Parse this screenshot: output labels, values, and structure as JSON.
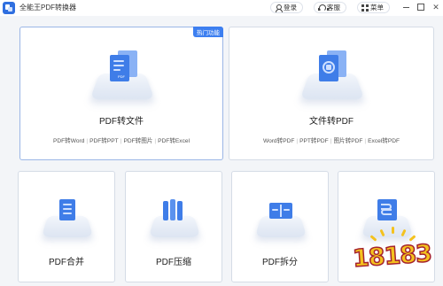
{
  "titlebar": {
    "app_title": "全能王PDF转换器",
    "login_label": "登录",
    "service_label": "客服",
    "menu_label": "菜单"
  },
  "cards": {
    "pdf_to_doc": {
      "badge": "热门功能",
      "title": "PDF转文件",
      "subs": [
        "PDF转Word",
        "PDF转PPT",
        "PDF转图片",
        "PDF转Excel"
      ]
    },
    "doc_to_pdf": {
      "title": "文件转PDF",
      "subs": [
        "Word转PDF",
        "PPT转PDF",
        "图片转PDF",
        "Excel转PDF"
      ]
    },
    "merge": {
      "title": "PDF合并"
    },
    "compress": {
      "title": "PDF压缩"
    },
    "split": {
      "title": "PDF拆分"
    }
  },
  "watermark": {
    "text": "18183"
  },
  "colors": {
    "accent": "#3d7ff0",
    "icon_blue": "#3f7de8",
    "watermark_fill": "#f4c21e",
    "watermark_stroke": "#a5232e"
  },
  "icons": {
    "app_logo": "pdf-converter-logo-icon",
    "login": "user-icon",
    "service": "headset-icon",
    "menu": "grid-menu-icon"
  }
}
